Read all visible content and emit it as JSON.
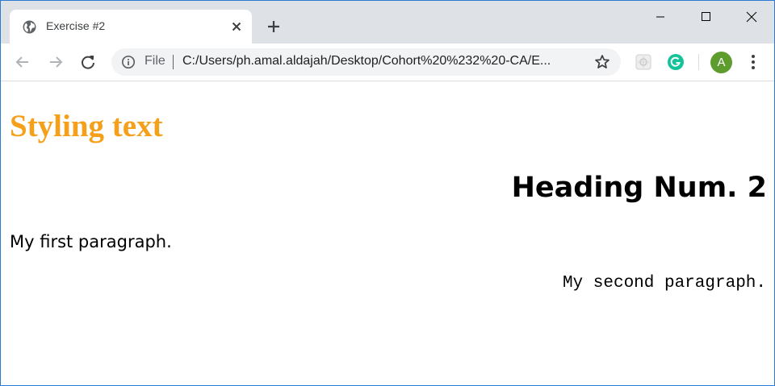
{
  "browser": {
    "tab": {
      "title": "Exercise #2"
    },
    "omnibox": {
      "scheme_chip": "File",
      "url": "C:/Users/ph.amal.aldajah/Desktop/Cohort%20%232%20-CA/E..."
    },
    "profile": {
      "initial": "A",
      "color": "#5f9c2e"
    },
    "icons": {
      "tab_favicon": "globe-icon",
      "tab_close": "close-icon",
      "new_tab": "plus-icon",
      "minimize": "minimize-icon",
      "maximize": "maximize-icon",
      "close_window": "close-icon",
      "back": "back-arrow-icon",
      "forward": "forward-arrow-icon",
      "reload": "reload-icon",
      "site_info": "info-icon",
      "bookmark": "star-icon",
      "extension": "extension-icon",
      "grammarly": "grammarly-icon",
      "menu": "kebab-menu-icon"
    }
  },
  "page": {
    "heading1": "Styling text",
    "heading1_color": "#f5a01a",
    "heading2": "Heading Num. 2",
    "paragraph1": "My first paragraph.",
    "paragraph2": "My second paragraph."
  }
}
